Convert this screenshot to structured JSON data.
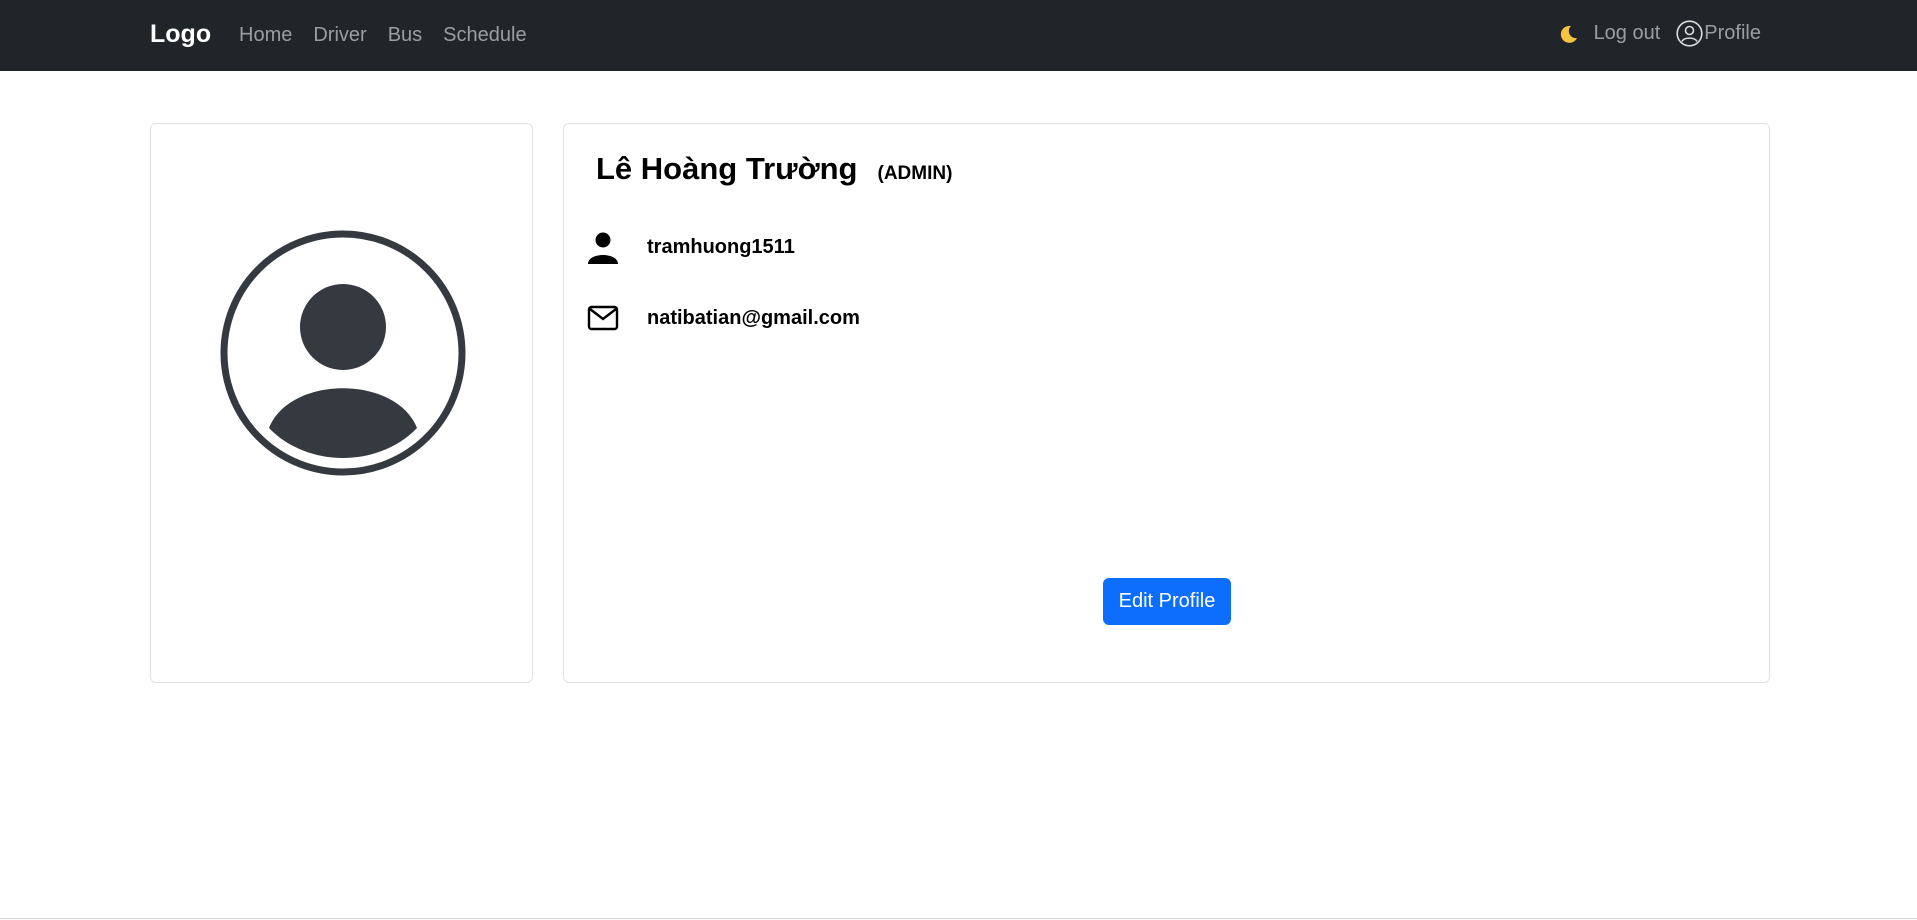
{
  "navbar": {
    "brand": "Logo",
    "links": [
      "Home",
      "Driver",
      "Bus",
      "Schedule"
    ],
    "theme_icon": "moon-icon",
    "logout_label": "Log out",
    "profile_label": "Profile",
    "profile_icon": "user-circle-icon"
  },
  "profile": {
    "name": "Lê Hoàng Trường",
    "role": "(ADMIN)",
    "username": "tramhuong1511",
    "email": "natibatian@gmail.com",
    "edit_button_label": "Edit Profile"
  },
  "colors": {
    "navbar_bg": "#212529",
    "primary": "#0d6efd",
    "avatar": "#343a40",
    "moon": "#f5c542"
  }
}
